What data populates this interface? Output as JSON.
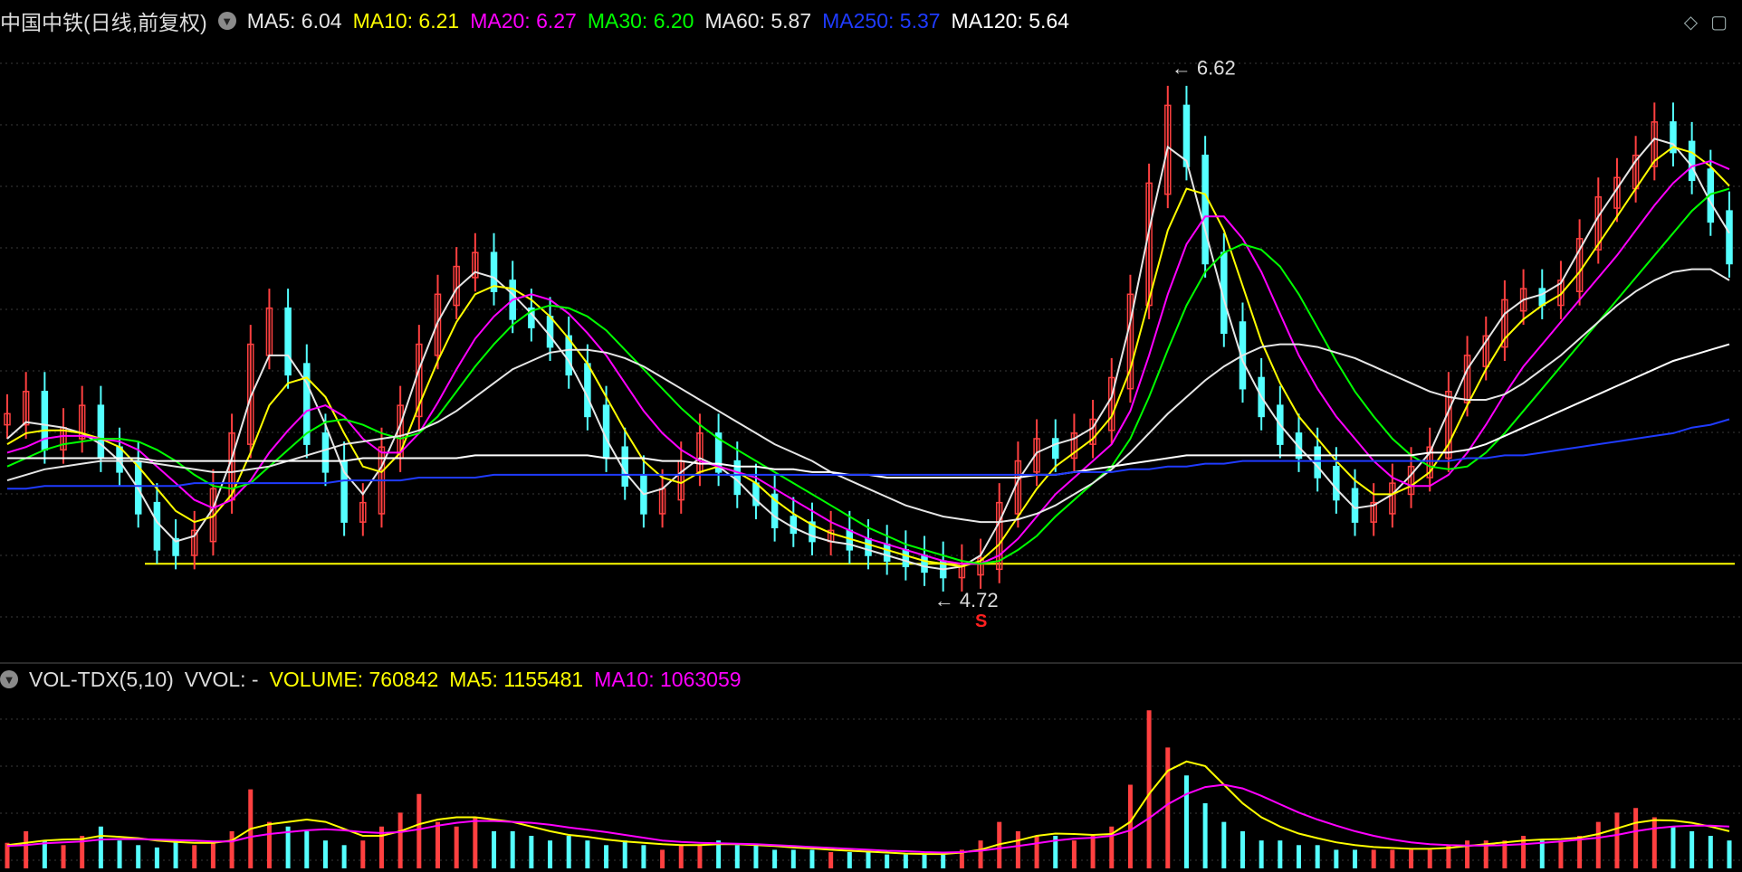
{
  "title": "中国中铁(日线,前复权)",
  "price_legend": [
    {
      "label": "MA5: 6.04",
      "color": "#e6e6e6"
    },
    {
      "label": "MA10: 6.21",
      "color": "#ffff00"
    },
    {
      "label": "MA20: 6.27",
      "color": "#ff00ff"
    },
    {
      "label": "MA30: 6.20",
      "color": "#00ff00"
    },
    {
      "label": "MA60: 5.87",
      "color": "#e6e6e6"
    },
    {
      "label": "MA250: 5.37",
      "color": "#1f3bff"
    },
    {
      "label": "MA120: 5.64",
      "color": "#ffffff"
    }
  ],
  "volume_legend": [
    {
      "label": "VOL-TDX(5,10)",
      "color": "#dddddd"
    },
    {
      "label": "VVOL: -",
      "color": "#dddddd"
    },
    {
      "label": "VOLUME: 760842",
      "color": "#ffff00"
    },
    {
      "label": "MA5: 1155481",
      "color": "#ffff00"
    },
    {
      "label": "MA10: 1063059",
      "color": "#ff00ff"
    }
  ],
  "annotations": {
    "high": "6.62",
    "low": "4.72",
    "marker": "S"
  },
  "icons": {
    "diamond": "diamond-icon",
    "window": "window-icon"
  },
  "colors": {
    "up": "#ff4040",
    "down": "#54ffff",
    "support": "#ffff00",
    "grid": "#555555"
  },
  "chart_data": {
    "type": "candlestick",
    "y_range": [
      4.6,
      6.7
    ],
    "support_level": 4.85,
    "candles": [
      5.37,
      5.45,
      5.28,
      5.32,
      5.4,
      5.25,
      5.2,
      5.05,
      4.92,
      4.9,
      4.95,
      5.1,
      5.3,
      5.62,
      5.75,
      5.55,
      5.3,
      5.2,
      5.02,
      5.05,
      5.25,
      5.4,
      5.62,
      5.8,
      5.9,
      5.95,
      5.85,
      5.75,
      5.72,
      5.65,
      5.55,
      5.4,
      5.25,
      5.15,
      5.05,
      5.1,
      5.2,
      5.3,
      5.2,
      5.12,
      5.08,
      5.0,
      4.98,
      4.95,
      4.95,
      4.92,
      4.9,
      4.88,
      4.86,
      4.84,
      4.82,
      4.83,
      4.85,
      5.05,
      5.2,
      5.28,
      5.25,
      5.3,
      5.35,
      5.5,
      5.8,
      6.2,
      6.48,
      6.3,
      5.95,
      5.7,
      5.5,
      5.4,
      5.3,
      5.25,
      5.18,
      5.1,
      5.02,
      5.05,
      5.12,
      5.18,
      5.25,
      5.45,
      5.58,
      5.65,
      5.78,
      5.82,
      5.8,
      5.85,
      6.0,
      6.15,
      6.22,
      6.3,
      6.42,
      6.35,
      6.25,
      6.1,
      5.95
    ],
    "series": [
      {
        "name": "MA5",
        "values": [
          5.3,
          5.36,
          5.35,
          5.34,
          5.32,
          5.28,
          5.22,
          5.12,
          5.0,
          4.93,
          4.95,
          5.05,
          5.23,
          5.45,
          5.6,
          5.6,
          5.5,
          5.35,
          5.18,
          5.1,
          5.2,
          5.35,
          5.55,
          5.72,
          5.84,
          5.9,
          5.88,
          5.82,
          5.75,
          5.67,
          5.58,
          5.45,
          5.3,
          5.18,
          5.1,
          5.12,
          5.18,
          5.23,
          5.2,
          5.15,
          5.08,
          5.02,
          4.98,
          4.95,
          4.93,
          4.92,
          4.9,
          4.88,
          4.86,
          4.84,
          4.83,
          4.84,
          4.88,
          5.0,
          5.15,
          5.25,
          5.28,
          5.3,
          5.34,
          5.45,
          5.72,
          6.05,
          6.35,
          6.3,
          6.05,
          5.8,
          5.58,
          5.45,
          5.35,
          5.27,
          5.2,
          5.12,
          5.05,
          5.06,
          5.1,
          5.17,
          5.25,
          5.4,
          5.55,
          5.65,
          5.75,
          5.8,
          5.82,
          5.86,
          5.98,
          6.1,
          6.2,
          6.3,
          6.38,
          6.36,
          6.28,
          6.15,
          6.04
        ]
      },
      {
        "name": "MA10",
        "values": [
          5.28,
          5.32,
          5.33,
          5.33,
          5.32,
          5.3,
          5.27,
          5.2,
          5.12,
          5.04,
          5.0,
          5.02,
          5.1,
          5.25,
          5.42,
          5.5,
          5.52,
          5.45,
          5.32,
          5.2,
          5.18,
          5.25,
          5.42,
          5.58,
          5.72,
          5.82,
          5.85,
          5.84,
          5.8,
          5.74,
          5.66,
          5.57,
          5.45,
          5.33,
          5.22,
          5.16,
          5.14,
          5.18,
          5.2,
          5.18,
          5.14,
          5.08,
          5.03,
          4.99,
          4.96,
          4.94,
          4.92,
          4.9,
          4.88,
          4.86,
          4.85,
          4.84,
          4.86,
          4.92,
          5.02,
          5.12,
          5.2,
          5.25,
          5.3,
          5.38,
          5.55,
          5.8,
          6.05,
          6.2,
          6.18,
          6.05,
          5.85,
          5.65,
          5.5,
          5.38,
          5.3,
          5.22,
          5.15,
          5.1,
          5.1,
          5.13,
          5.18,
          5.28,
          5.42,
          5.55,
          5.66,
          5.73,
          5.78,
          5.82,
          5.9,
          6.0,
          6.1,
          6.2,
          6.3,
          6.35,
          6.33,
          6.28,
          6.21
        ]
      },
      {
        "name": "MA20",
        "values": [
          5.25,
          5.27,
          5.3,
          5.31,
          5.31,
          5.3,
          5.29,
          5.26,
          5.2,
          5.14,
          5.08,
          5.05,
          5.08,
          5.15,
          5.25,
          5.33,
          5.4,
          5.42,
          5.38,
          5.3,
          5.25,
          5.25,
          5.32,
          5.43,
          5.55,
          5.66,
          5.74,
          5.8,
          5.82,
          5.8,
          5.75,
          5.68,
          5.6,
          5.5,
          5.4,
          5.32,
          5.26,
          5.22,
          5.2,
          5.18,
          5.16,
          5.12,
          5.08,
          5.04,
          5.0,
          4.97,
          4.94,
          4.92,
          4.9,
          4.88,
          4.86,
          4.85,
          4.85,
          4.88,
          4.94,
          5.02,
          5.1,
          5.16,
          5.22,
          5.28,
          5.4,
          5.6,
          5.82,
          6.0,
          6.1,
          6.1,
          6.02,
          5.9,
          5.75,
          5.6,
          5.48,
          5.38,
          5.3,
          5.22,
          5.16,
          5.13,
          5.13,
          5.17,
          5.25,
          5.35,
          5.46,
          5.56,
          5.64,
          5.72,
          5.8,
          5.88,
          5.96,
          6.05,
          6.14,
          6.22,
          6.28,
          6.3,
          6.27
        ]
      },
      {
        "name": "MA30",
        "values": [
          5.2,
          5.23,
          5.26,
          5.28,
          5.29,
          5.3,
          5.3,
          5.29,
          5.26,
          5.22,
          5.17,
          5.13,
          5.12,
          5.14,
          5.2,
          5.26,
          5.32,
          5.36,
          5.37,
          5.35,
          5.32,
          5.3,
          5.32,
          5.38,
          5.47,
          5.56,
          5.64,
          5.71,
          5.76,
          5.78,
          5.77,
          5.74,
          5.69,
          5.62,
          5.55,
          5.48,
          5.41,
          5.35,
          5.3,
          5.26,
          5.22,
          5.18,
          5.14,
          5.1,
          5.06,
          5.02,
          4.98,
          4.95,
          4.92,
          4.9,
          4.88,
          4.86,
          4.85,
          4.86,
          4.9,
          4.95,
          5.02,
          5.08,
          5.14,
          5.2,
          5.3,
          5.45,
          5.62,
          5.78,
          5.9,
          5.97,
          6.0,
          5.98,
          5.92,
          5.82,
          5.7,
          5.58,
          5.47,
          5.38,
          5.3,
          5.24,
          5.2,
          5.19,
          5.2,
          5.25,
          5.32,
          5.4,
          5.48,
          5.56,
          5.64,
          5.72,
          5.8,
          5.88,
          5.96,
          6.04,
          6.12,
          6.18,
          6.2
        ]
      },
      {
        "name": "MA60",
        "values": [
          5.15,
          5.17,
          5.19,
          5.2,
          5.21,
          5.22,
          5.22,
          5.22,
          5.21,
          5.2,
          5.19,
          5.18,
          5.18,
          5.19,
          5.2,
          5.22,
          5.24,
          5.26,
          5.28,
          5.29,
          5.3,
          5.31,
          5.33,
          5.36,
          5.4,
          5.45,
          5.5,
          5.55,
          5.58,
          5.61,
          5.62,
          5.62,
          5.61,
          5.59,
          5.56,
          5.52,
          5.48,
          5.44,
          5.4,
          5.36,
          5.32,
          5.28,
          5.25,
          5.22,
          5.18,
          5.15,
          5.12,
          5.09,
          5.06,
          5.04,
          5.02,
          5.01,
          5.0,
          5.0,
          5.01,
          5.03,
          5.06,
          5.1,
          5.14,
          5.19,
          5.25,
          5.32,
          5.39,
          5.45,
          5.51,
          5.56,
          5.6,
          5.63,
          5.64,
          5.64,
          5.63,
          5.61,
          5.59,
          5.56,
          5.53,
          5.5,
          5.47,
          5.45,
          5.44,
          5.44,
          5.46,
          5.5,
          5.55,
          5.6,
          5.66,
          5.72,
          5.78,
          5.83,
          5.87,
          5.9,
          5.91,
          5.91,
          5.87
        ]
      },
      {
        "name": "MA120",
        "values": [
          5.23,
          5.23,
          5.23,
          5.23,
          5.23,
          5.23,
          5.23,
          5.23,
          5.22,
          5.22,
          5.22,
          5.22,
          5.22,
          5.22,
          5.22,
          5.22,
          5.22,
          5.22,
          5.22,
          5.23,
          5.23,
          5.23,
          5.23,
          5.23,
          5.23,
          5.24,
          5.24,
          5.24,
          5.24,
          5.24,
          5.24,
          5.24,
          5.23,
          5.23,
          5.23,
          5.22,
          5.22,
          5.21,
          5.21,
          5.2,
          5.2,
          5.19,
          5.19,
          5.18,
          5.18,
          5.17,
          5.17,
          5.16,
          5.16,
          5.16,
          5.16,
          5.16,
          5.16,
          5.16,
          5.16,
          5.17,
          5.17,
          5.18,
          5.19,
          5.2,
          5.21,
          5.22,
          5.23,
          5.24,
          5.24,
          5.24,
          5.24,
          5.24,
          5.24,
          5.24,
          5.24,
          5.24,
          5.24,
          5.24,
          5.24,
          5.24,
          5.25,
          5.25,
          5.26,
          5.28,
          5.31,
          5.34,
          5.37,
          5.4,
          5.43,
          5.46,
          5.49,
          5.52,
          5.55,
          5.58,
          5.6,
          5.62,
          5.64
        ]
      },
      {
        "name": "MA250",
        "values": [
          5.12,
          5.12,
          5.13,
          5.13,
          5.13,
          5.13,
          5.13,
          5.13,
          5.13,
          5.13,
          5.14,
          5.14,
          5.14,
          5.14,
          5.14,
          5.14,
          5.14,
          5.14,
          5.15,
          5.15,
          5.15,
          5.15,
          5.16,
          5.16,
          5.16,
          5.16,
          5.17,
          5.17,
          5.17,
          5.17,
          5.17,
          5.17,
          5.17,
          5.17,
          5.17,
          5.17,
          5.17,
          5.17,
          5.17,
          5.17,
          5.17,
          5.17,
          5.17,
          5.17,
          5.17,
          5.17,
          5.17,
          5.17,
          5.17,
          5.17,
          5.17,
          5.17,
          5.17,
          5.17,
          5.17,
          5.17,
          5.17,
          5.18,
          5.18,
          5.18,
          5.19,
          5.19,
          5.2,
          5.2,
          5.21,
          5.21,
          5.22,
          5.22,
          5.22,
          5.22,
          5.22,
          5.22,
          5.22,
          5.22,
          5.22,
          5.22,
          5.22,
          5.22,
          5.23,
          5.23,
          5.24,
          5.24,
          5.25,
          5.26,
          5.27,
          5.28,
          5.29,
          5.3,
          5.31,
          5.32,
          5.34,
          5.35,
          5.37
        ]
      }
    ],
    "volume": [
      0.55,
      0.8,
      0.6,
      0.5,
      0.7,
      0.9,
      0.6,
      0.5,
      0.45,
      0.6,
      0.5,
      0.55,
      0.8,
      1.7,
      1.0,
      0.9,
      0.8,
      0.6,
      0.5,
      0.6,
      0.9,
      1.2,
      1.6,
      1.0,
      0.9,
      1.1,
      0.8,
      0.8,
      0.7,
      0.6,
      0.7,
      0.6,
      0.5,
      0.6,
      0.5,
      0.4,
      0.5,
      0.5,
      0.6,
      0.5,
      0.5,
      0.4,
      0.4,
      0.4,
      0.35,
      0.35,
      0.35,
      0.3,
      0.3,
      0.3,
      0.3,
      0.4,
      0.6,
      1.0,
      0.8,
      0.7,
      0.7,
      0.6,
      0.7,
      0.9,
      1.8,
      3.4,
      2.6,
      2.0,
      1.4,
      1.0,
      0.8,
      0.6,
      0.6,
      0.5,
      0.5,
      0.4,
      0.4,
      0.4,
      0.4,
      0.4,
      0.4,
      0.5,
      0.6,
      0.6,
      0.6,
      0.7,
      0.6,
      0.6,
      0.7,
      1.0,
      1.2,
      1.3,
      1.1,
      0.9,
      0.8,
      0.7,
      0.6
    ],
    "volume_ma5": [
      0.5,
      0.55,
      0.6,
      0.62,
      0.63,
      0.7,
      0.68,
      0.65,
      0.6,
      0.57,
      0.55,
      0.55,
      0.6,
      0.85,
      0.95,
      1.0,
      1.05,
      1.0,
      0.85,
      0.7,
      0.7,
      0.8,
      0.95,
      1.05,
      1.1,
      1.1,
      1.05,
      1.0,
      0.9,
      0.8,
      0.72,
      0.68,
      0.62,
      0.58,
      0.55,
      0.52,
      0.5,
      0.5,
      0.52,
      0.52,
      0.5,
      0.48,
      0.45,
      0.43,
      0.4,
      0.38,
      0.36,
      0.34,
      0.32,
      0.31,
      0.31,
      0.34,
      0.4,
      0.52,
      0.6,
      0.7,
      0.75,
      0.74,
      0.72,
      0.74,
      1.0,
      1.6,
      2.1,
      2.3,
      2.2,
      1.8,
      1.4,
      1.1,
      0.9,
      0.75,
      0.65,
      0.56,
      0.5,
      0.46,
      0.44,
      0.42,
      0.42,
      0.44,
      0.48,
      0.52,
      0.56,
      0.6,
      0.62,
      0.63,
      0.66,
      0.74,
      0.86,
      0.98,
      1.04,
      1.03,
      0.98,
      0.9,
      0.8
    ],
    "volume_ma10": [
      0.48,
      0.5,
      0.54,
      0.56,
      0.58,
      0.62,
      0.63,
      0.63,
      0.62,
      0.61,
      0.6,
      0.58,
      0.58,
      0.68,
      0.74,
      0.78,
      0.82,
      0.84,
      0.82,
      0.78,
      0.76,
      0.78,
      0.84,
      0.92,
      0.98,
      1.02,
      1.02,
      1.0,
      0.98,
      0.94,
      0.88,
      0.83,
      0.78,
      0.72,
      0.66,
      0.6,
      0.57,
      0.55,
      0.54,
      0.53,
      0.52,
      0.5,
      0.48,
      0.46,
      0.44,
      0.42,
      0.4,
      0.38,
      0.37,
      0.35,
      0.34,
      0.35,
      0.38,
      0.43,
      0.48,
      0.54,
      0.6,
      0.64,
      0.66,
      0.7,
      0.82,
      1.08,
      1.38,
      1.6,
      1.75,
      1.8,
      1.72,
      1.56,
      1.38,
      1.2,
      1.05,
      0.92,
      0.8,
      0.7,
      0.62,
      0.56,
      0.52,
      0.5,
      0.49,
      0.49,
      0.5,
      0.52,
      0.55,
      0.58,
      0.62,
      0.66,
      0.72,
      0.8,
      0.86,
      0.9,
      0.92,
      0.92,
      0.9
    ]
  }
}
